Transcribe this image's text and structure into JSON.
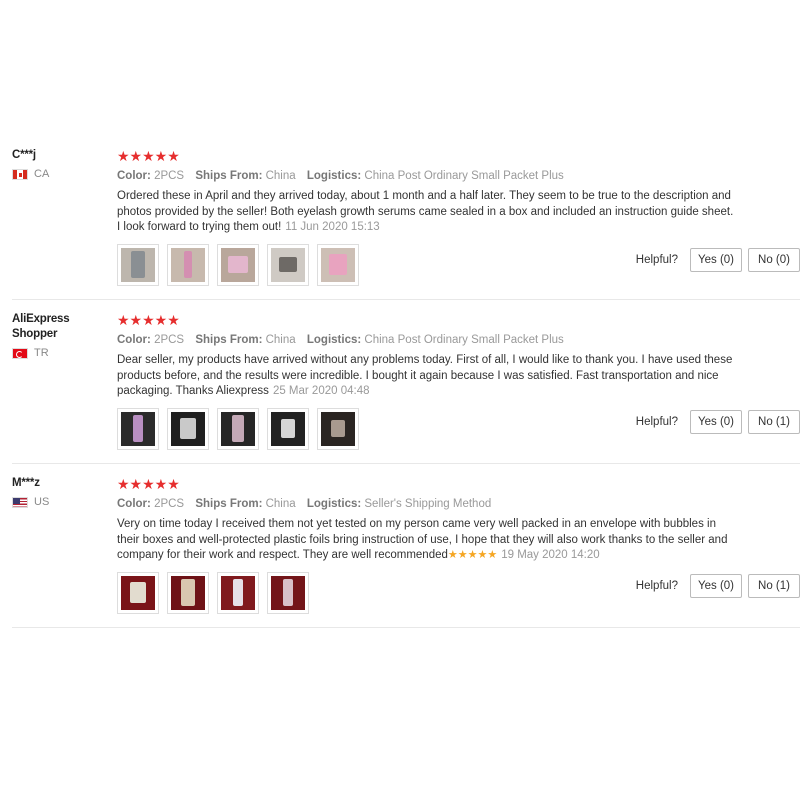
{
  "labels": {
    "color": "Color:",
    "ships_from": "Ships From:",
    "logistics": "Logistics:",
    "helpful": "Helpful?"
  },
  "icons": {
    "rating_star": "star-icon",
    "flag": "flag-icon"
  },
  "colors": {
    "rating_star": "#e62e2e",
    "inline_star": "#f5a623",
    "date": "#999999"
  },
  "reviews": [
    {
      "user_name": "C***j",
      "country": "CA",
      "stars": "★★★★★",
      "rating": 5,
      "color": "2PCS",
      "ships_from": "China",
      "logistics": "China Post Ordinary Small Packet Plus",
      "text": "Ordered these in April and they arrived today, about 1 month and a half later. They seem to be true to the description and photos provided by the seller! Both eyelash growth serums came sealed in a box and included an instruction guide sheet. I look forward to trying them out!",
      "inline_stars": "",
      "date": "11 Jun 2020 15:13",
      "photos": 5,
      "yes_label": "Yes (0)",
      "no_label": "No (0)"
    },
    {
      "user_name": "AliExpress Shopper",
      "country": "TR",
      "stars": "★★★★★",
      "rating": 5,
      "color": "2PCS",
      "ships_from": "China",
      "logistics": "China Post Ordinary Small Packet Plus",
      "text": "Dear seller, my products have arrived without any problems today. First of all, I would like to thank you. I have used these products before, and the results were incredible. I bought it again because I was satisfied. Fast transportation and nice packaging. Thanks Aliexpress",
      "inline_stars": "",
      "date": "25 Mar 2020 04:48",
      "photos": 5,
      "yes_label": "Yes (0)",
      "no_label": "No (1)"
    },
    {
      "user_name": "M***z",
      "country": "US",
      "stars": "★★★★★",
      "rating": 5,
      "color": "2PCS",
      "ships_from": "China",
      "logistics": "Seller's Shipping Method",
      "text": "Very on time today I received them not yet tested on my person came very well packed in an envelope with bubbles in their boxes and well-protected plastic foils bring instruction of use, I hope that they will also work thanks to the seller and company for their work and respect. They are well recommended",
      "inline_stars": "★★★★★",
      "date": "19 May 2020 14:20",
      "photos": 4,
      "yes_label": "Yes (0)",
      "no_label": "No (1)"
    }
  ]
}
